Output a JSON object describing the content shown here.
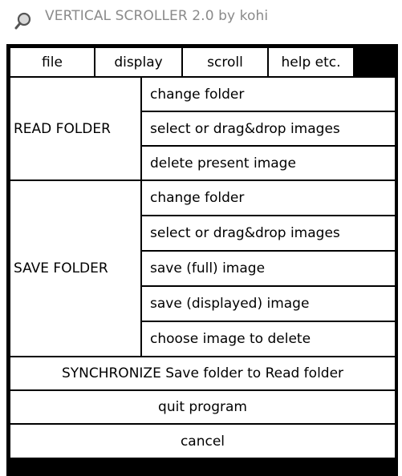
{
  "window": {
    "title": "VERTICAL SCROLLER 2.0 by kohi",
    "icon": "search-icon"
  },
  "menubar": {
    "tabs": [
      {
        "label": "file"
      },
      {
        "label": "display"
      },
      {
        "label": "scroll"
      },
      {
        "label": "help etc."
      }
    ]
  },
  "read_folder": {
    "label": "READ FOLDER",
    "actions": [
      {
        "label": "change folder"
      },
      {
        "label": "select or drag&drop images"
      },
      {
        "label": "delete present image"
      }
    ]
  },
  "save_folder": {
    "label": "SAVE FOLDER",
    "actions": [
      {
        "label": "change folder"
      },
      {
        "label": "select or drag&drop images"
      },
      {
        "label": "save (full) image"
      },
      {
        "label": "save (displayed) image"
      },
      {
        "label": "choose image to delete"
      }
    ]
  },
  "bottom_actions": {
    "synchronize": "SYNCHRONIZE Save folder to Read folder",
    "quit": "quit program",
    "cancel": "cancel"
  }
}
